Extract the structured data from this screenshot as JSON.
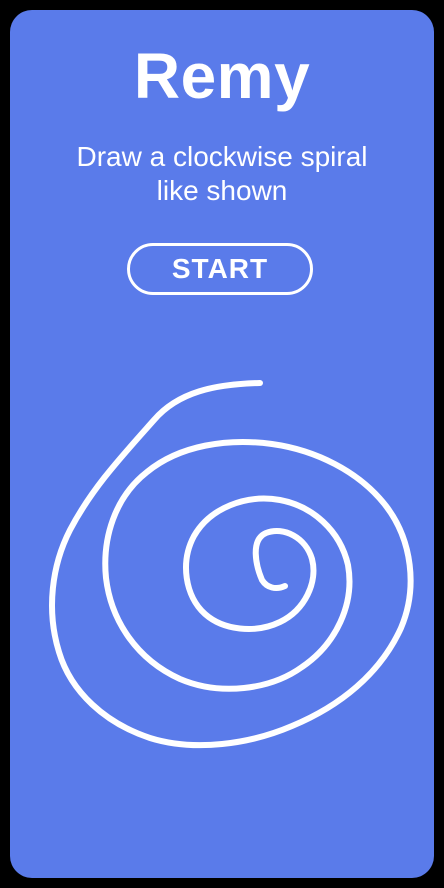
{
  "app": {
    "title": "Remy",
    "instruction": "Draw a clockwise spiral\nlike shown",
    "start_label": "START"
  },
  "colors": {
    "background": "#5A7BEA",
    "frame": "#000000",
    "foreground": "#FFFFFF"
  },
  "illustration": {
    "icon": "spiral-drawing-icon",
    "direction": "clockwise"
  }
}
